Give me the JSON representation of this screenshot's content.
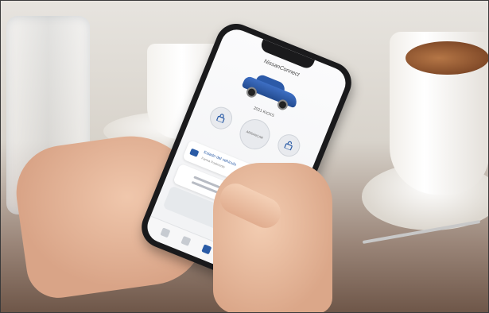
{
  "image": {
    "description_free": true
  },
  "phone_app": {
    "logo_text": "NissanConnect",
    "car_model": "2021 KICKS",
    "center_button": "ARRANCAR",
    "vehicle_status_title": "Estado del vehículo",
    "vehicle_status_subtitle": "Farma Posimente",
    "accent_color": "#2a5ba6",
    "car_color": "#2c5aa8"
  },
  "icons": {
    "lock": "lock-icon",
    "unlock": "unlock-icon",
    "chevron": "chevron-right-icon",
    "home": "home-icon"
  }
}
